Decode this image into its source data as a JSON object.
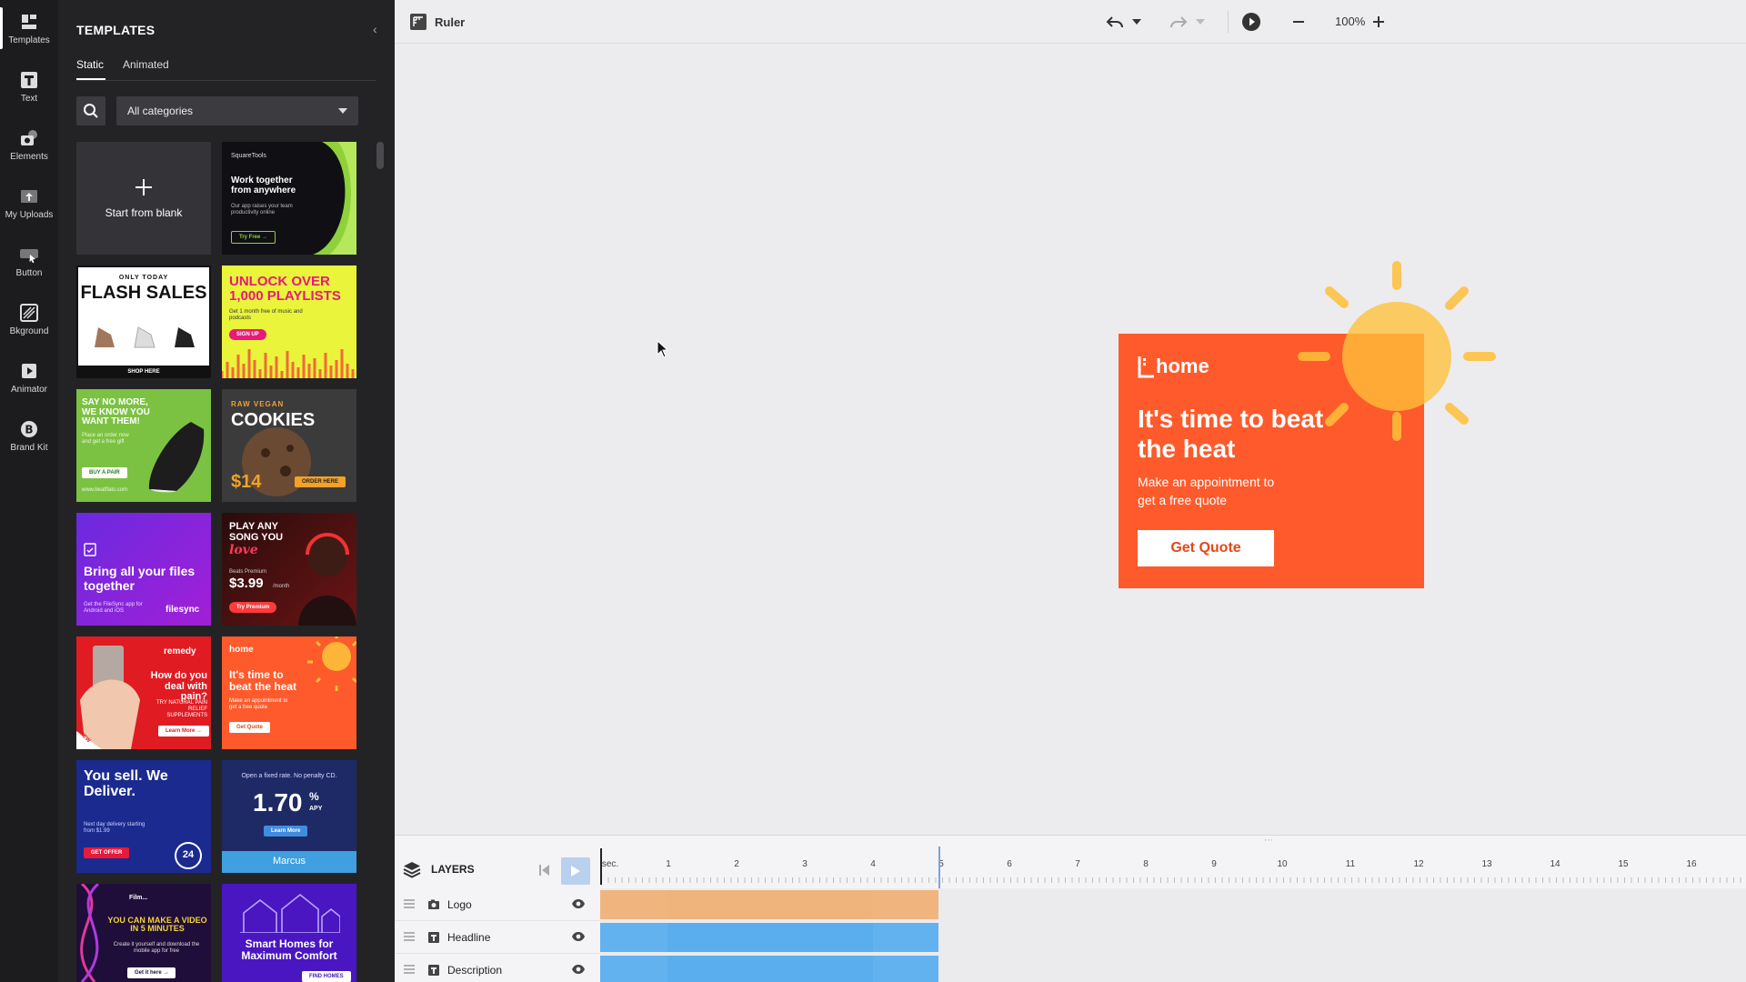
{
  "rail": {
    "items": [
      {
        "label": "Templates",
        "icon": "templates-icon"
      },
      {
        "label": "Text",
        "icon": "text-icon"
      },
      {
        "label": "Elements",
        "icon": "elements-icon"
      },
      {
        "label": "My Uploads",
        "icon": "uploads-icon"
      },
      {
        "label": "Button",
        "icon": "button-icon"
      },
      {
        "label": "Bkground",
        "icon": "background-icon"
      },
      {
        "label": "Animator",
        "icon": "animator-icon"
      },
      {
        "label": "Brand Kit",
        "icon": "brand-kit-icon"
      }
    ]
  },
  "panel": {
    "title": "TEMPLATES",
    "tabs": [
      "Static",
      "Animated"
    ],
    "category": "All categories",
    "start_blank": "Start from blank",
    "tiles": {
      "squaretools": {
        "brand": "SquareTools",
        "title": "Work together from anywhere",
        "sub": "Our app raises your team productivity online",
        "cta": "Try Free →"
      },
      "flash": {
        "top": "ONLY TODAY",
        "title": "FLASH SALES",
        "cta": "SHOP HERE"
      },
      "playlists": {
        "title": "UNLOCK OVER 1,000 PLAYLISTS",
        "sub": "Get 1 month free of music and podcasts",
        "cta": "SIGN UP"
      },
      "sneaker": {
        "title": "SAY NO MORE, WE KNOW YOU WANT THEM!",
        "sub": "Place an order now and get a free gift",
        "cta": "BUY A PAIR",
        "url": "www.beatflats.com"
      },
      "cookies": {
        "top": "RAW VEGAN",
        "title": "COOKIES",
        "price": "$14",
        "cta": "ORDER HERE"
      },
      "song": {
        "title": "PLAY ANY SONG YOU",
        "script": "love",
        "sub": "Beats Premium",
        "price": "$3.99",
        "per": "/month",
        "cta": "Try Premium"
      },
      "filesync": {
        "title": "Bring all your files together",
        "sub": "Get the FileSync app for Android and iOS",
        "brand": "filesync"
      },
      "remedy": {
        "brand": "remedy",
        "title": "How do you deal with pain?",
        "sub": "TRY NATURAL PAIN RELIEF SUPPLEMENTS",
        "cta": "Learn More →",
        "ribbon": "NEW"
      },
      "home_small": {
        "brand": "home",
        "title": "It's time to beat the heat",
        "sub": "Make an appointment to get a free quote",
        "cta": "Get Quote"
      },
      "deliver": {
        "title": "You sell. We Deliver.",
        "sub": "Next day delivery starting from $1.99",
        "cta": "GET OFFER",
        "badge": "24"
      },
      "marcus": {
        "top": "Open a fixed rate. No penalty CD.",
        "rate": "1.70",
        "unit": "%",
        "apy": "APY",
        "cta": "Learn More",
        "brand": "Marcus"
      },
      "video": {
        "brand": "Film...",
        "title": "YOU CAN MAKE A VIDEO IN 5 MINUTES",
        "sub": "Create it yourself and download the mobile app for free",
        "cta": "Get it here →"
      },
      "smarthome": {
        "title": "Smart Homes for Maximum Comfort",
        "cta": "FIND HOMES"
      }
    }
  },
  "toolbar": {
    "ruler": "Ruler",
    "zoom": "100%"
  },
  "ad": {
    "brand": "home",
    "headline": "It's time to beat the heat",
    "description": "Make an appointment to get a free quote",
    "cta": "Get Quote",
    "colors": {
      "background": "#fe5a2b",
      "sun": "#ffc03a"
    }
  },
  "timeline": {
    "title": "LAYERS",
    "unit": "sec.",
    "ticks": [
      "1",
      "2",
      "3",
      "4",
      "5",
      "6",
      "7",
      "8",
      "9",
      "10",
      "11",
      "12",
      "13",
      "14",
      "15",
      "16"
    ],
    "layers": [
      {
        "name": "Logo",
        "type": "image",
        "color": "orange"
      },
      {
        "name": "Headline",
        "type": "text",
        "color": "blue"
      },
      {
        "name": "Description",
        "type": "text",
        "color": "blue"
      }
    ]
  }
}
